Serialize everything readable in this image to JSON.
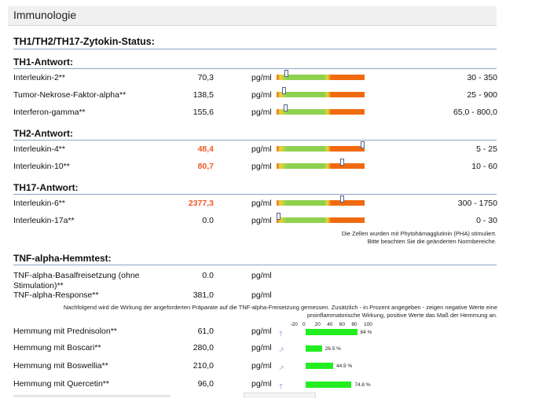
{
  "page": {
    "title": "Immunologie",
    "heading": "TH1/TH2/TH17-Zytokin-Status:"
  },
  "colors": {
    "high_value": "#f05a28",
    "bar_low": "#f06a10",
    "bar_normal": "#8fd14f",
    "inhibition_bar": "#22ee22",
    "rule": "#8aa4c4"
  },
  "groups": [
    {
      "title": "TH1-Antwort:"
    },
    {
      "title": "TH2-Antwort:"
    },
    {
      "title": "TH17-Antwort:"
    }
  ],
  "rows": [
    {
      "name": "Interleukin-2**",
      "value": "70,3",
      "unit": "pg/ml",
      "range": "30 - 350",
      "flag": "normal",
      "indicator": 0.11
    },
    {
      "name": "Tumor-Nekrose-Faktor-alpha**",
      "value": "138,5",
      "unit": "pg/ml",
      "range": "25 - 900",
      "flag": "normal",
      "indicator": 0.08
    },
    {
      "name": "Interferon-gamma**",
      "value": "155,6",
      "unit": "pg/ml",
      "range": "65,0 - 800,0",
      "flag": "normal",
      "indicator": 0.1
    },
    {
      "name": "Interleukin-4**",
      "value": "48,4",
      "unit": "pg/ml",
      "range": "5 - 25",
      "flag": "high",
      "indicator": 0.98
    },
    {
      "name": "Interleukin-10**",
      "value": "80,7",
      "unit": "pg/ml",
      "range": "10 - 60",
      "flag": "high",
      "indicator": 0.74
    },
    {
      "name": "Interleukin-6**",
      "value": "2377,3",
      "unit": "pg/ml",
      "range": "300 - 1750",
      "flag": "high",
      "indicator": 0.74
    },
    {
      "name": "Interleukin-17a**",
      "value": "0.0",
      "unit": "pg/ml",
      "range": "0 - 30",
      "flag": "normal",
      "indicator": 0.0
    }
  ],
  "pha_note": {
    "line1": "Die Zellen wurden mit Phytohämagglutinin (PHA) stimuliert.",
    "line2": "Bitte beachten Sie die geänderten Normbereiche."
  },
  "tnf": {
    "title": "TNF-alpha-Hemmtest:",
    "basal_name_line1": "TNF-alpha-Basalfreisetzung (ohne",
    "basal_name_line2": "Stimulation)**",
    "basal_value": "0.0",
    "basal_unit": "pg/ml",
    "response_name": "TNF-alpha-Response**",
    "response_value": "381,0",
    "response_unit": "pg/ml",
    "note_line1": "Nachfolgend wird die Wirkung der angeforderten Präparate auf die TNF-alpha-Freisetzung gemessen. Zusätzlich - in Prozent angegeben - zeigen negative Werte eine",
    "note_line2": "proinflammatorische Wirkung, positive Werte das Maß der Hemmung an.",
    "scale_ticks": [
      "-20",
      "0",
      "20",
      "40",
      "60",
      "80",
      "100"
    ],
    "inhibitions": [
      {
        "name": "Hemmung mit Prednisolon**",
        "value": "61,0",
        "unit": "pg/ml",
        "arrow": "up-arrow-icon",
        "percent": 84,
        "percent_label": "84 %"
      },
      {
        "name": "Hemmung mit Boscari**",
        "value": "280,0",
        "unit": "pg/ml",
        "arrow": "diagonal-arrow-icon",
        "percent": 26.5,
        "percent_label": "26.5 %"
      },
      {
        "name": "Hemmung mit Boswellia**",
        "value": "210,0",
        "unit": "pg/ml",
        "arrow": "diagonal-arrow-icon",
        "percent": 44.9,
        "percent_label": "44.9 %"
      },
      {
        "name": "Hemmung mit Quercetin**",
        "value": "96,0",
        "unit": "pg/ml",
        "arrow": "up-arrow-icon",
        "percent": 74.8,
        "percent_label": "74.8 %"
      }
    ]
  }
}
